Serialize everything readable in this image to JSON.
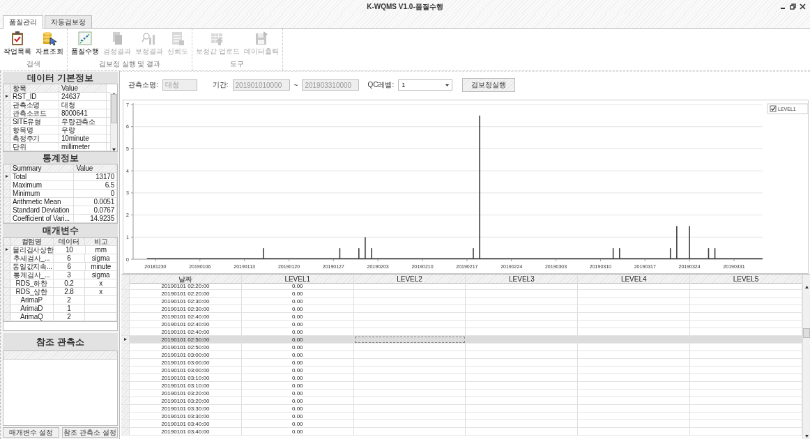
{
  "window": {
    "title": "K-WQMS V1.0-품질수행"
  },
  "ribbon": {
    "tabs": [
      {
        "label": "품질관리",
        "selected": true
      },
      {
        "label": "자동검보정",
        "selected": false
      }
    ],
    "groups": [
      {
        "label": "검색",
        "buttons": [
          {
            "label": "작업목록",
            "kind": "clipboard",
            "disabled": false
          },
          {
            "label": "자료조회",
            "kind": "database",
            "disabled": false
          }
        ]
      },
      {
        "label": "검보정 실행 및 결과",
        "buttons": [
          {
            "label": "품질수행",
            "kind": "trend",
            "disabled": false
          },
          {
            "label": "검정결과",
            "kind": "copy",
            "disabled": true
          },
          {
            "label": "보정결과",
            "kind": "inspect",
            "disabled": true
          },
          {
            "label": "신뢰도",
            "kind": "sheet",
            "disabled": true
          }
        ]
      },
      {
        "label": "도구",
        "buttons": [
          {
            "label": "보정값 업로드",
            "kind": "upload",
            "disabled": true
          },
          {
            "label": "데이터출력",
            "kind": "save",
            "disabled": true
          }
        ]
      }
    ]
  },
  "basic_info": {
    "title": "데이터 기본정보",
    "columns": [
      "항목",
      "Value"
    ],
    "rows": [
      {
        "item": "RST_ID",
        "value": "24637",
        "selected": true
      },
      {
        "item": "관측소명",
        "value": "대청",
        "selected": false
      },
      {
        "item": "관측소코드",
        "value": "8000641",
        "selected": false
      },
      {
        "item": "SITE유형",
        "value": "우량관측소",
        "selected": false
      },
      {
        "item": "항목명",
        "value": "우량",
        "selected": false
      },
      {
        "item": "측정주기",
        "value": "10minute",
        "selected": false
      },
      {
        "item": "단위",
        "value": "millimeter",
        "selected": false
      }
    ]
  },
  "statistics": {
    "title": "통계정보",
    "columns": [
      "Summary",
      "Value"
    ],
    "rows": [
      {
        "item": "Total",
        "value": "13170",
        "selected": true
      },
      {
        "item": "Maximum",
        "value": "6.5",
        "selected": false
      },
      {
        "item": "Minimum",
        "value": "0",
        "selected": false
      },
      {
        "item": "Arithmetic Mean",
        "value": "0.0051",
        "selected": false
      },
      {
        "item": "Standard Deviation",
        "value": "0.0767",
        "selected": false
      },
      {
        "item": "Coefficient of Vari...",
        "value": "14.9235",
        "selected": false
      }
    ]
  },
  "parameters": {
    "title": "매개변수",
    "columns": [
      "컬럼명",
      "데이터",
      "비고"
    ],
    "rows": [
      {
        "name": "물리검사상한",
        "data": "10",
        "note": "mm",
        "selected": true
      },
      {
        "name": "추세검사_...",
        "data": "6",
        "note": "sigma",
        "selected": false
      },
      {
        "name": "동일값지속...",
        "data": "6",
        "note": "minute",
        "selected": false
      },
      {
        "name": "통계검사_...",
        "data": "3",
        "note": "sigma",
        "selected": false
      },
      {
        "name": "RDS_하한",
        "data": "0.2",
        "note": "x",
        "selected": false
      },
      {
        "name": "RDS_상한",
        "data": "2.8",
        "note": "x",
        "selected": false
      },
      {
        "name": "ArimaP",
        "data": "2",
        "selected": false
      },
      {
        "name": "ArimaD",
        "data": "1",
        "selected": false
      },
      {
        "name": "ArimaQ",
        "data": "2",
        "selected": false
      }
    ]
  },
  "reference_stations": {
    "title": "참조 관측소"
  },
  "side_buttons": [
    "매개변수 설정",
    "참조 관측소 설정"
  ],
  "toolbar": {
    "station_label": "관측소명:",
    "station": {
      "value": "대청",
      "disabled": true
    },
    "period_label": "기간:",
    "period_from": {
      "value": "201901010000",
      "disabled": true
    },
    "period_separator": "~",
    "period_to": {
      "value": "201903310000",
      "disabled": true
    },
    "qc_label": "QC레벨:",
    "qc_level": "1",
    "run_button": "검보정실행"
  },
  "chart": {
    "legend_checked": true,
    "chart_data": {
      "type": "bar",
      "categories": [
        null,
        null,
        null,
        "20181230",
        null,
        null,
        null,
        null,
        null,
        null,
        "20190106",
        null,
        null,
        null,
        null,
        null,
        null,
        "20190113",
        null,
        null,
        null,
        null,
        null,
        null,
        "20190120",
        null,
        null,
        null,
        null,
        null,
        null,
        "20190127",
        null,
        null,
        null,
        null,
        null,
        null,
        "20190203",
        null,
        null,
        null,
        null,
        null,
        null,
        "20190210",
        null,
        null,
        null,
        null,
        null,
        null,
        "20190217",
        null,
        null,
        null,
        null,
        null,
        null,
        "20190224",
        null,
        null,
        null,
        null,
        null,
        null,
        "20190303",
        null,
        null,
        null,
        null,
        null,
        null,
        "20190310",
        null,
        null,
        null,
        null,
        null,
        null,
        "20190317",
        null,
        null,
        null,
        null,
        null,
        null,
        "20190324",
        null,
        null,
        null,
        null,
        null,
        null,
        "20190331",
        null,
        null,
        null,
        null
      ],
      "series": [
        {
          "name": "LEVEL1",
          "color": "#404040",
          "values": [
            null,
            null,
            0,
            0,
            0,
            0,
            0,
            0,
            0,
            0,
            0,
            0,
            0,
            0,
            0,
            0,
            0,
            0,
            0,
            0,
            0.5,
            0,
            0,
            0,
            0,
            0,
            0,
            0,
            0,
            0,
            0,
            0,
            0.5,
            0,
            0,
            0.5,
            1,
            0.5,
            0,
            0,
            0,
            0,
            0,
            0,
            0,
            0,
            0,
            0,
            0,
            0,
            0,
            0,
            0,
            0.5,
            6.5,
            0,
            0,
            0,
            0,
            0,
            0,
            0,
            0,
            0,
            0,
            0,
            0,
            0,
            0,
            0,
            0,
            0,
            0,
            0,
            0,
            0.5,
            0.5,
            0,
            0,
            0,
            0,
            0,
            0,
            0,
            0.5,
            1.5,
            0,
            1.5,
            0,
            0,
            0.5,
            0.5,
            0,
            0,
            0,
            0,
            0,
            0,
            0
          ]
        }
      ],
      "ylim": [
        0,
        7
      ],
      "yticks": [
        0,
        1,
        2,
        3,
        4,
        5,
        6,
        7
      ],
      "grid": true
    }
  },
  "grid": {
    "columns": [
      "날짜",
      "LEVEL1",
      "LEVEL2",
      "LEVEL3",
      "LEVEL4",
      "LEVEL5"
    ],
    "rows": [
      {
        "date": "20190101 02:20:00",
        "level1": "0.00",
        "selected": false
      },
      {
        "date": "20190101 02:20:00",
        "level1": "0.00",
        "selected": false
      },
      {
        "date": "20190101 02:30:00",
        "level1": "0.00",
        "selected": false
      },
      {
        "date": "20190101 02:30:00",
        "level1": "0.00",
        "selected": false
      },
      {
        "date": "20190101 02:40:00",
        "level1": "0.00",
        "selected": false
      },
      {
        "date": "20190101 02:40:00",
        "level1": "0.00",
        "selected": false
      },
      {
        "date": "20190101 02:40:00",
        "level1": "0.00",
        "selected": false
      },
      {
        "date": "20190101 02:50:00",
        "level1": "0.00",
        "selected": true
      },
      {
        "date": "20190101 02:50:00",
        "level1": "0.00",
        "selected": false
      },
      {
        "date": "20190101 03:00:00",
        "level1": "0.00",
        "selected": false
      },
      {
        "date": "20190101 03:00:00",
        "level1": "0.00",
        "selected": false
      },
      {
        "date": "20190101 03:00:00",
        "level1": "0.00",
        "selected": false
      },
      {
        "date": "20190101 03:10:00",
        "level1": "0.00",
        "selected": false
      },
      {
        "date": "20190101 03:10:00",
        "level1": "0.00",
        "selected": false
      },
      {
        "date": "20190101 03:20:00",
        "level1": "0.00",
        "selected": false
      },
      {
        "date": "20190101 03:20:00",
        "level1": "0.00",
        "selected": false
      },
      {
        "date": "20190101 03:30:00",
        "level1": "0.00",
        "selected": false
      },
      {
        "date": "20190101 03:30:00",
        "level1": "0.00",
        "selected": false
      },
      {
        "date": "20190101 03:40:00",
        "level1": "0.00",
        "selected": false
      },
      {
        "date": "20190101 03:40:00",
        "level1": "0.00",
        "selected": false
      }
    ]
  }
}
